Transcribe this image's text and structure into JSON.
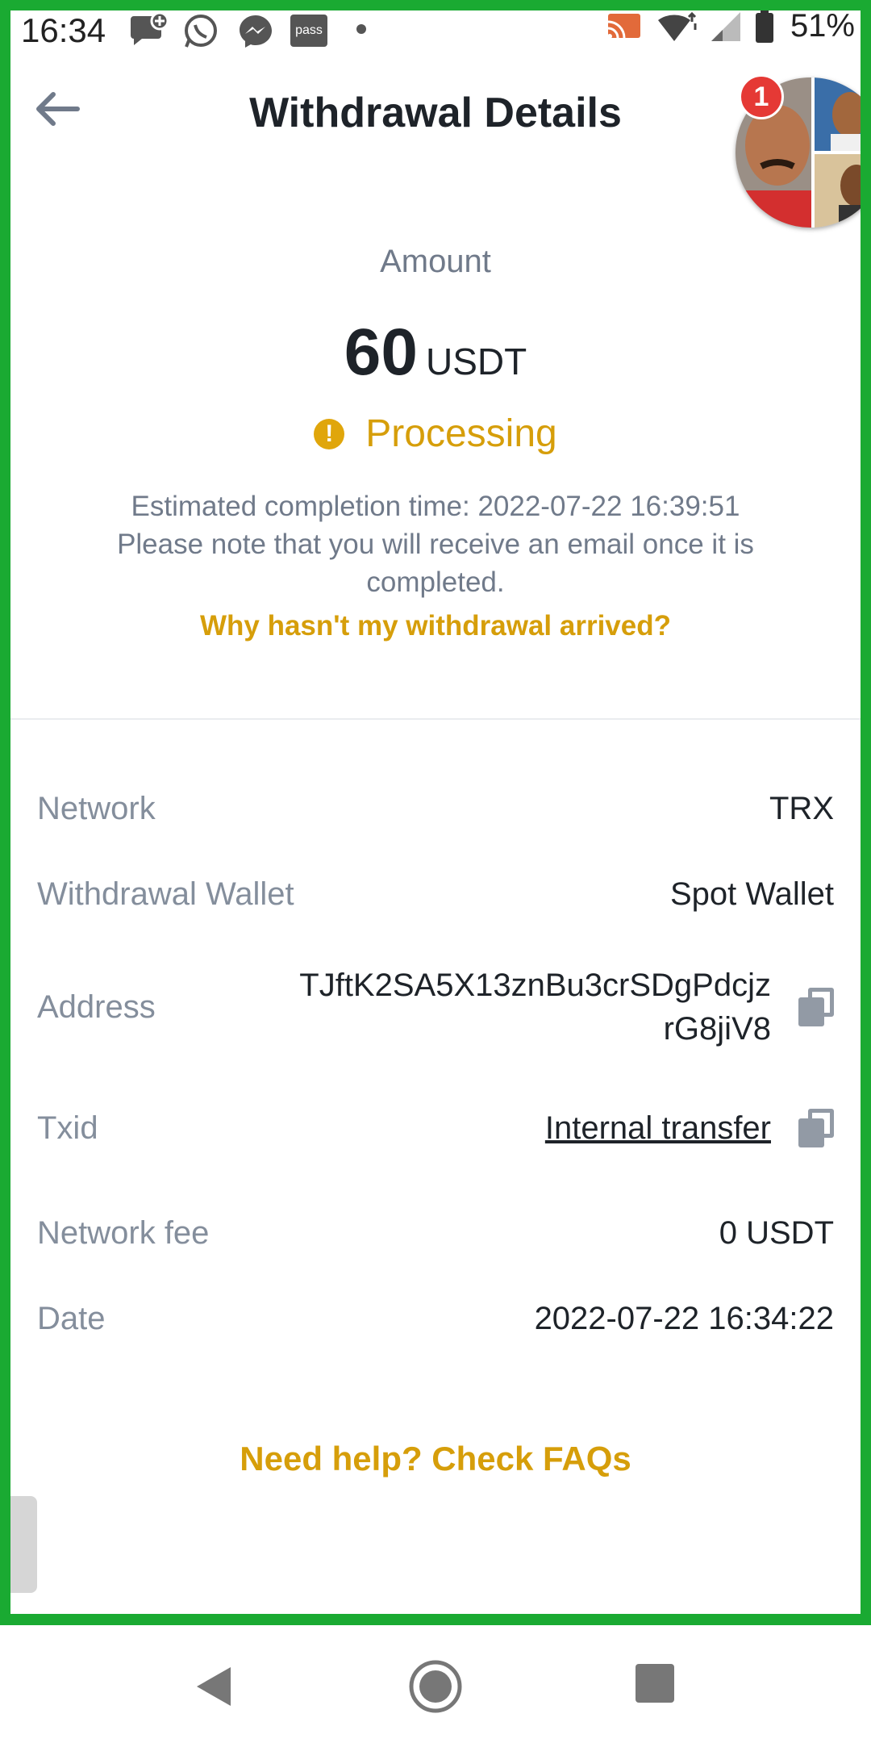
{
  "status_bar": {
    "time": "16:34",
    "battery_percent": "51%",
    "left_icons": [
      "chat-plus-icon",
      "whatsapp-icon",
      "messenger-icon",
      "pass-icon",
      "dot-icon"
    ],
    "pass_label": "pass",
    "right_icons": [
      "cast-icon",
      "wifi-icon",
      "signal-icon",
      "battery-icon"
    ]
  },
  "header": {
    "title": "Withdrawal Details",
    "back_icon": "arrow-left-icon"
  },
  "chat_bubble": {
    "badge_count": "1"
  },
  "summary": {
    "amount_label": "Amount",
    "amount_value": "60",
    "amount_unit": "USDT",
    "status": "Processing",
    "status_icon": "exclamation-circle-icon",
    "note_line1": "Estimated completion time: 2022-07-22 16:39:51",
    "note_line2": "Please note that you will receive an email once it is completed.",
    "help_link": "Why hasn't my withdrawal arrived?"
  },
  "details": {
    "network": {
      "label": "Network",
      "value": "TRX"
    },
    "wallet": {
      "label": "Withdrawal Wallet",
      "value": "Spot Wallet"
    },
    "address": {
      "label": "Address",
      "value_line1": "TJftK2SA5X13znBu3crSDgPdcjz",
      "value_line2": "rG8jiV8"
    },
    "txid": {
      "label": "Txid",
      "value": "Internal transfer "
    },
    "fee": {
      "label": "Network fee",
      "value": "0 USDT"
    },
    "date": {
      "label": "Date",
      "value": "2022-07-22 16:34:22"
    }
  },
  "faq_link": "Need help? Check FAQs",
  "colors": {
    "accent": "#d69e0a",
    "recording_frame": "#1aaa32",
    "label_gray": "#848e9c",
    "text_dark": "#1e2329"
  },
  "nav_bar": {
    "icons": [
      "back-triangle-icon",
      "home-circle-icon",
      "recents-square-icon"
    ]
  }
}
